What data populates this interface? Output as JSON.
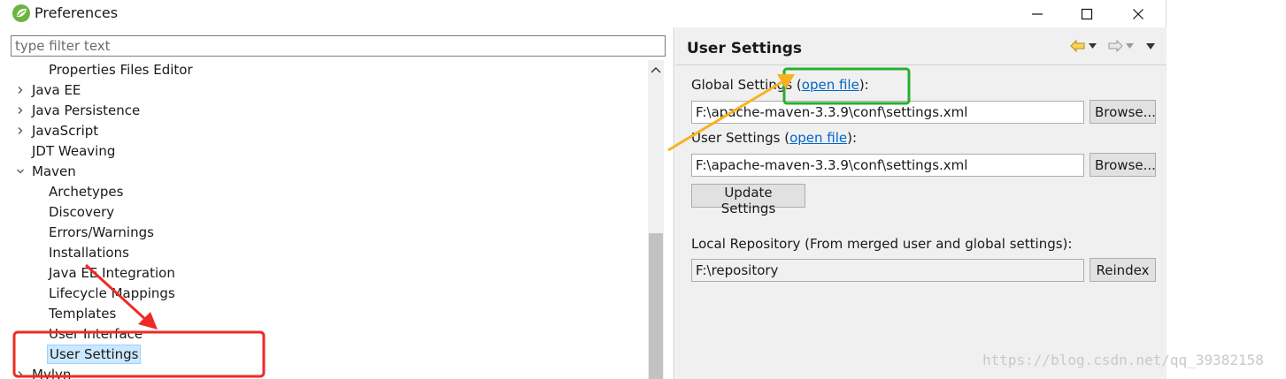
{
  "window": {
    "title": "Preferences",
    "controls": [
      "minimize",
      "maximize",
      "close"
    ]
  },
  "left": {
    "filter_placeholder": "type filter text",
    "tree": [
      {
        "label": "Properties Files Editor",
        "level": 2,
        "expander": "none",
        "selected": false
      },
      {
        "label": "Java EE",
        "level": 1,
        "expander": "collapsed",
        "selected": false
      },
      {
        "label": "Java Persistence",
        "level": 1,
        "expander": "collapsed",
        "selected": false
      },
      {
        "label": "JavaScript",
        "level": 1,
        "expander": "collapsed",
        "selected": false
      },
      {
        "label": "JDT Weaving",
        "level": 1,
        "expander": "none",
        "selected": false
      },
      {
        "label": "Maven",
        "level": 1,
        "expander": "expanded",
        "selected": false
      },
      {
        "label": "Archetypes",
        "level": 2,
        "expander": "none",
        "selected": false
      },
      {
        "label": "Discovery",
        "level": 2,
        "expander": "none",
        "selected": false
      },
      {
        "label": "Errors/Warnings",
        "level": 2,
        "expander": "none",
        "selected": false
      },
      {
        "label": "Installations",
        "level": 2,
        "expander": "none",
        "selected": false
      },
      {
        "label": "Java EE Integration",
        "level": 2,
        "expander": "none",
        "selected": false
      },
      {
        "label": "Lifecycle Mappings",
        "level": 2,
        "expander": "none",
        "selected": false
      },
      {
        "label": "Templates",
        "level": 2,
        "expander": "none",
        "selected": false
      },
      {
        "label": "User Interface",
        "level": 2,
        "expander": "none",
        "selected": false
      },
      {
        "label": "User Settings",
        "level": 2,
        "expander": "none",
        "selected": true
      },
      {
        "label": "Mylyn",
        "level": 1,
        "expander": "collapsed",
        "selected": false
      }
    ]
  },
  "right": {
    "page_title": "User Settings",
    "global": {
      "label_prefix": "Global Settings (",
      "link": "open file",
      "label_suffix": "):",
      "value": "F:\\apache-maven-3.3.9\\conf\\settings.xml",
      "browse_label": "Browse..."
    },
    "user": {
      "label_prefix": "User Settings (",
      "link": "open file",
      "label_suffix": "):",
      "value": "F:\\apache-maven-3.3.9\\conf\\settings.xml",
      "browse_label": "Browse..."
    },
    "update_label": "Update Settings",
    "local_repo": {
      "label": "Local Repository (From merged user and global settings):",
      "value": "F:\\repository",
      "reindex_label": "Reindex"
    }
  },
  "colors": {
    "annotation_red": "#ee2a24",
    "annotation_green": "#27b02e",
    "annotation_orange": "#f7b31f",
    "link_blue": "#0066cc",
    "selection": "#cce8ff"
  },
  "watermark": "https://blog.csdn.net/qq_39382158"
}
